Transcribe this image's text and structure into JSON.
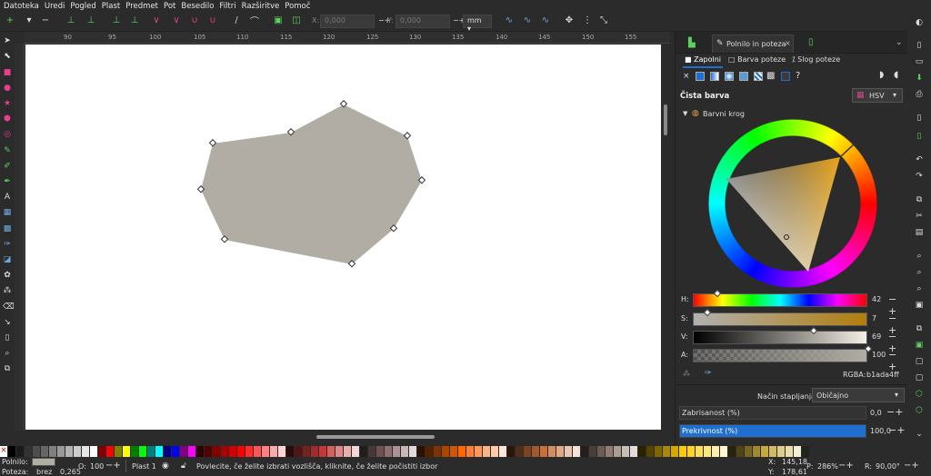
{
  "menu": [
    "Datoteka",
    "Uredi",
    "Pogled",
    "Plast",
    "Predmet",
    "Pot",
    "Besedilo",
    "Filtri",
    "Razširitve",
    "Pomoč"
  ],
  "toolbar": {
    "x_label": "X:",
    "x_value": "0,000",
    "y_label": "Y:",
    "y_value": "0,000",
    "unit": "mm"
  },
  "ruler_ticks": [
    "90",
    "95",
    "100",
    "105",
    "110",
    "115",
    "120",
    "125",
    "130",
    "135",
    "140",
    "145",
    "150",
    "155"
  ],
  "dock": {
    "tab_title": "Polnilo in poteza",
    "subtabs": [
      "Zapolni",
      "Barva poteze",
      "Slog poteze"
    ],
    "section_title": "Čista barva",
    "mode": "HSV",
    "wheel_label": "Barvni krog",
    "sliders": [
      {
        "label": "H:",
        "value": "42"
      },
      {
        "label": "S:",
        "value": "7"
      },
      {
        "label": "V:",
        "value": "69"
      },
      {
        "label": "A:",
        "value": "100"
      }
    ],
    "rgba_label": "RGBA:",
    "rgba_value": "b1ada4ff",
    "blend_label": "Način stapljanja:",
    "blend_value": "Običajno",
    "blur_label": "Zabrisanost (%)",
    "blur_value": "0,0",
    "opacity_label": "Prekrivnost (%)",
    "opacity_value": "100,0"
  },
  "status": {
    "fill_label": "Polnilo:",
    "stroke_label": "Poteza:",
    "stroke_value": "brez",
    "stroke_width": "0,265",
    "opacity_label": "O:",
    "opacity_value": "100",
    "layer": "Plast 1",
    "message": "Povlecite, če želite izbrati vozlišča, kliknite, če želite počistiti izbor",
    "x_label": "X:",
    "x_value": "145,18",
    "y_label": "Y:",
    "y_value": "178,61",
    "zoom_label": "P:",
    "zoom_value": "286%",
    "rot_label": "R:",
    "rot_value": "90,00°"
  },
  "colors": {
    "shape_fill": "#b1ada4",
    "accent": "#1f6fd1"
  },
  "palette": [
    "#000000",
    "#1a1a1a",
    "#333333",
    "#4d4d4d",
    "#666666",
    "#808080",
    "#999999",
    "#b3b3b3",
    "#cccccc",
    "#e6e6e6",
    "#ffffff",
    "#800000",
    "#ff0000",
    "#808000",
    "#ffff00",
    "#008000",
    "#00ff00",
    "#008080",
    "#00ffff",
    "#000080",
    "#0000ff",
    "#800080",
    "#ff00ff",
    "#2b0000",
    "#550000",
    "#800000",
    "#aa0000",
    "#d40000",
    "#ff0000",
    "#ff2a2a",
    "#ff5555",
    "#ff8080",
    "#ffaaaa",
    "#ffd5d5",
    "#280b0b",
    "#501616",
    "#782121",
    "#a02c2c",
    "#c83737",
    "#d35f5f",
    "#de8787",
    "#e9afaf",
    "#f4d7d7",
    "#241c1c",
    "#483737",
    "#6c5353",
    "#916f6f",
    "#ac9393",
    "#c8b7b7",
    "#e3dbdb",
    "#2b1100",
    "#552200",
    "#803300",
    "#aa4400",
    "#d45500",
    "#ff6600",
    "#ff7f2a",
    "#ff9955",
    "#ffb380",
    "#ffccaa",
    "#ffe6d5",
    "#28170b",
    "#502d16",
    "#784421",
    "#a05a2c",
    "#c87137",
    "#d38d5f",
    "#deaa87",
    "#e9c6af",
    "#f4e3d7",
    "#241f1c",
    "#483e37",
    "#6c5d53",
    "#917c6f",
    "#ac9d93",
    "#c8beb7",
    "#e3dedb",
    "#2b2200",
    "#554400",
    "#806600",
    "#aa8800",
    "#d4aa00",
    "#ffcc00",
    "#ffd42a",
    "#ffdd55",
    "#ffe680",
    "#ffeeaa",
    "#fff6d5",
    "#28220b",
    "#504416",
    "#786721",
    "#a0892c",
    "#c8ab37",
    "#d3bc5f",
    "#decd87",
    "#e9ddaf",
    "#f4eed7",
    "#24221c"
  ]
}
